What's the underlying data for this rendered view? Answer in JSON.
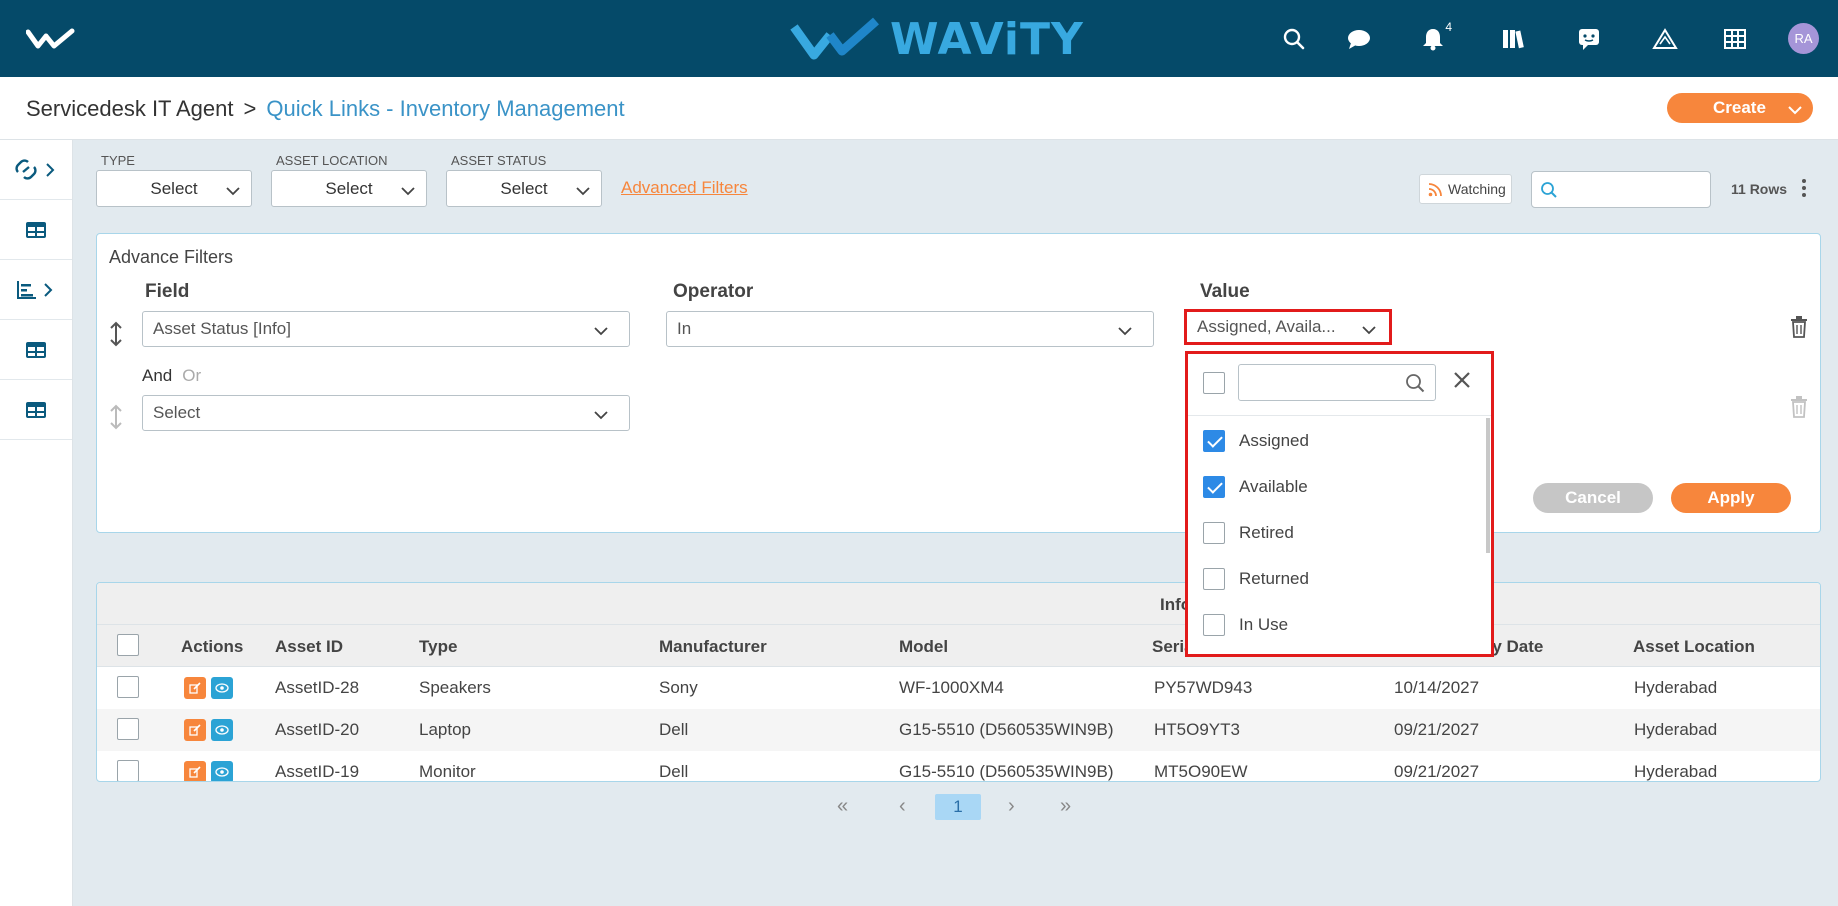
{
  "header": {
    "brand_name": "WAViTY",
    "notification_count": "4",
    "avatar_initials": "RA"
  },
  "breadcrumb": {
    "root": "Servicedesk IT Agent",
    "separator": ">",
    "current": "Quick Links - Inventory Management"
  },
  "create_button": {
    "label": "Create"
  },
  "filters": {
    "type": {
      "label": "TYPE",
      "value": "Select"
    },
    "location": {
      "label": "ASSET LOCATION",
      "value": "Select"
    },
    "status": {
      "label": "ASSET STATUS",
      "value": "Select"
    },
    "advanced_link": "Advanced Filters",
    "watching_label": "Watching",
    "search_placeholder": "",
    "rows_count": "11 Rows"
  },
  "advance_filters": {
    "title": "Advance Filters",
    "columns": {
      "field": "Field",
      "operator": "Operator",
      "value": "Value"
    },
    "rule1": {
      "field": "Asset Status [Info]",
      "operator": "In",
      "value": "Assigned, Availa..."
    },
    "conjunction": {
      "and": "And",
      "or": "Or"
    },
    "rule2": {
      "field": "Select"
    },
    "cancel_label": "Cancel",
    "apply_label": "Apply"
  },
  "value_dropdown": {
    "search_placeholder": "",
    "options": [
      {
        "label": "Assigned",
        "checked": true
      },
      {
        "label": "Available",
        "checked": true
      },
      {
        "label": "Retired",
        "checked": false
      },
      {
        "label": "Returned",
        "checked": false
      },
      {
        "label": "In Use",
        "checked": false
      }
    ]
  },
  "table": {
    "group_header": "Info",
    "columns": {
      "actions": "Actions",
      "asset_id": "Asset ID",
      "type": "Type",
      "manufacturer": "Manufacturer",
      "model": "Model",
      "serial": "Seria",
      "expiry": "iry Date",
      "location": "Asset Location"
    },
    "rows": [
      {
        "asset_id": "AssetID-28",
        "type": "Speakers",
        "manufacturer": "Sony",
        "model": "WF-1000XM4",
        "serial": "PY57WD943",
        "expiry": "10/14/2027",
        "location": "Hyderabad"
      },
      {
        "asset_id": "AssetID-20",
        "type": "Laptop",
        "manufacturer": "Dell",
        "model": "G15-5510 (D560535WIN9B)",
        "serial": "HT5O9YT3",
        "expiry": "09/21/2027",
        "location": "Hyderabad"
      },
      {
        "asset_id": "AssetID-19",
        "type": "Monitor",
        "manufacturer": "Dell",
        "model": "G15-5510 (D560535WIN9B)",
        "serial": "MT5O90EW",
        "expiry": "09/21/2027",
        "location": "Hyderabad"
      }
    ]
  },
  "pagination": {
    "first": "«",
    "prev": "‹",
    "current": "1",
    "next": "›",
    "last": "»"
  },
  "colors": {
    "topbar": "#054a69",
    "accent": "#f7863c",
    "brand_blue": "#38a9e0",
    "highlight": "#e21b1b"
  }
}
